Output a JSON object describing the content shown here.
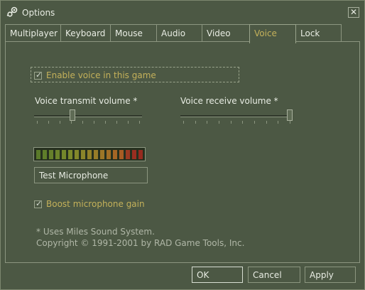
{
  "window": {
    "title": "Options",
    "close_label": "✕"
  },
  "tabs": [
    {
      "label": "Multiplayer"
    },
    {
      "label": "Keyboard"
    },
    {
      "label": "Mouse"
    },
    {
      "label": "Audio"
    },
    {
      "label": "Video"
    },
    {
      "label": "Voice",
      "active": true
    },
    {
      "label": "Lock"
    }
  ],
  "voice": {
    "enable_label": "Enable voice in this game",
    "enable_checked": true,
    "transmit_label": "Voice transmit volume *",
    "transmit_value": 0.35,
    "receive_label": "Voice receive volume *",
    "receive_value": 1.0,
    "test_mic_label": "Test Microphone",
    "boost_label": "Boost microphone gain",
    "boost_checked": true,
    "note_line1": "* Uses Miles Sound System.",
    "note_line2": "Copyright © 1991-2001 by RAD Game Tools, Inc."
  },
  "buttons": {
    "ok": "OK",
    "cancel": "Cancel",
    "apply": "Apply"
  },
  "colors": {
    "accent": "#c4b15a",
    "background": "#4c5844"
  }
}
